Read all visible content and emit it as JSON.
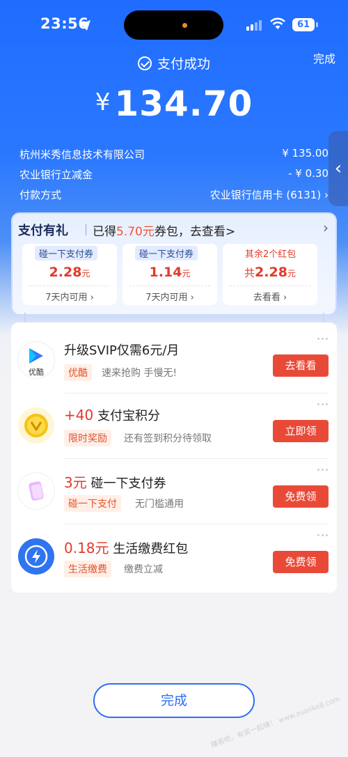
{
  "status_bar": {
    "time": "23:56",
    "battery": "61"
  },
  "header": {
    "success_text": "支付成功",
    "done_label": "完成"
  },
  "payment": {
    "currency": "¥",
    "amount": "134.70"
  },
  "details": [
    {
      "label": "杭州米秀信息技术有限公司",
      "value": "¥ 135.00"
    },
    {
      "label": "农业银行立减金",
      "value": "- ¥ 0.30"
    },
    {
      "label": "付款方式",
      "value": "农业银行信用卡 (6131) ›"
    }
  ],
  "side_tab": {
    "glyph": "‹"
  },
  "gift": {
    "title": "支付有礼",
    "sub_prefix": "已得",
    "sub_amount": "5.70元",
    "sub_suffix": "券包，去查看>",
    "coupons": [
      {
        "tag": "碰一下支付券",
        "value": "2.28",
        "unit": "元",
        "footer": "7天内可用 ›"
      },
      {
        "tag": "碰一下支付券",
        "value": "1.14",
        "unit": "元",
        "footer": "7天内可用 ›"
      },
      {
        "tag": "其余2个红包",
        "prefix": "共",
        "value": "2.28",
        "unit": "元",
        "footer": "去看看 ›"
      }
    ]
  },
  "offers": [
    {
      "icon": "youku-icon",
      "icon_label": "优酷",
      "title": "升级SVIP仅需6元/月",
      "price": "",
      "tag": "优酷",
      "desc": "速来抢购 手慢无!",
      "button": "去看看"
    },
    {
      "icon": "points-coin-icon",
      "title": "支付宝积分",
      "price": "+40",
      "tag": "限时奖励",
      "desc": "还有签到积分待领取",
      "button": "立即领"
    },
    {
      "icon": "coupon-card-icon",
      "title": "碰一下支付券",
      "price": "3元",
      "tag": "碰一下支付",
      "desc": "无门槛通用",
      "button": "免费领"
    },
    {
      "icon": "lightning-icon",
      "title": "生活缴费红包",
      "price": "0.18元",
      "tag": "生活缴费",
      "desc": "缴费立减",
      "button": "免费领"
    }
  ],
  "footer": {
    "done_label": "完成"
  },
  "watermark": "赚客吧，有奖一起赚！ www.zuanke8.com",
  "colors": {
    "primary_blue": "#2b78ff",
    "accent_red": "#e94a38"
  }
}
